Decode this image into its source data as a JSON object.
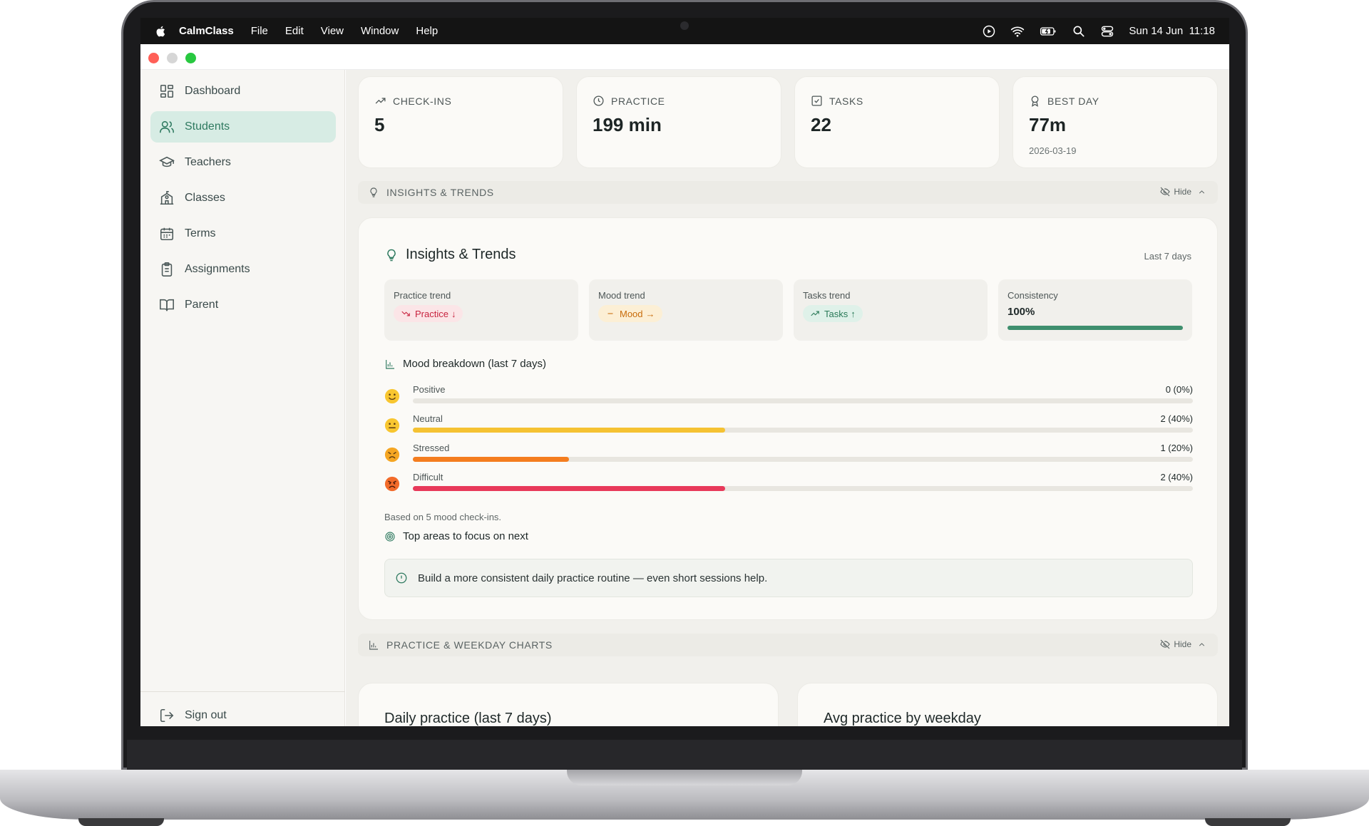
{
  "menubar": {
    "app_name": "CalmClass",
    "items": [
      "File",
      "Edit",
      "View",
      "Window",
      "Help"
    ],
    "datetime": "Sun 14 Jun  11:18"
  },
  "sidebar": {
    "items": [
      {
        "label": "Dashboard",
        "icon": "dashboard-icon"
      },
      {
        "label": "Students",
        "icon": "users-icon",
        "active": true
      },
      {
        "label": "Teachers",
        "icon": "graduation-cap-icon"
      },
      {
        "label": "Classes",
        "icon": "school-icon"
      },
      {
        "label": "Terms",
        "icon": "calendar-icon"
      },
      {
        "label": "Assignments",
        "icon": "clipboard-icon"
      },
      {
        "label": "Parent",
        "icon": "book-icon"
      }
    ],
    "sign_out": "Sign out"
  },
  "stats": {
    "checkins": {
      "label": "CHECK-INS",
      "value": "5"
    },
    "practice": {
      "label": "PRACTICE",
      "value": "199 min"
    },
    "tasks": {
      "label": "TASKS",
      "value": "22"
    },
    "best_day": {
      "label": "BEST DAY",
      "value": "77m",
      "date": "2026-03-19"
    }
  },
  "insights_section": {
    "bar_label": "INSIGHTS & TRENDS",
    "hide_label": "Hide",
    "title": "Insights & Trends",
    "range": "Last 7 days",
    "trends": {
      "practice": {
        "label": "Practice trend",
        "pill": "Practice",
        "arrow": "↓"
      },
      "mood": {
        "label": "Mood trend",
        "pill": "Mood",
        "arrow": "→"
      },
      "tasks": {
        "label": "Tasks trend",
        "pill": "Tasks",
        "arrow": "↑"
      },
      "consistency": {
        "label": "Consistency",
        "value": "100%",
        "fraction": 1.0
      }
    },
    "mood_heading": "Mood breakdown (last 7 days)",
    "moods": [
      {
        "name": "Positive",
        "count": "0 (0%)",
        "fraction": 0.0,
        "color": "#f5c232"
      },
      {
        "name": "Neutral",
        "count": "2 (40%)",
        "fraction": 0.4,
        "color": "#f5c232"
      },
      {
        "name": "Stressed",
        "count": "1 (20%)",
        "fraction": 0.2,
        "color": "#f47d1f"
      },
      {
        "name": "Difficult",
        "count": "2 (40%)",
        "fraction": 0.4,
        "color": "#e8395a"
      }
    ],
    "based_on": "Based on 5 mood check-ins.",
    "focus_heading": "Top areas to focus on next",
    "focus_items": [
      "Build a more consistent daily practice routine — even short sessions help."
    ]
  },
  "charts_section": {
    "bar_label": "PRACTICE & WEEKDAY CHARTS",
    "hide_label": "Hide",
    "daily_title": "Daily practice (last 7 days)",
    "weekday_title": "Avg practice by weekday"
  },
  "colors": {
    "accent": "#2f7a60",
    "active_nav_bg": "#d7ece4",
    "consistency": "#3f8f6e"
  }
}
